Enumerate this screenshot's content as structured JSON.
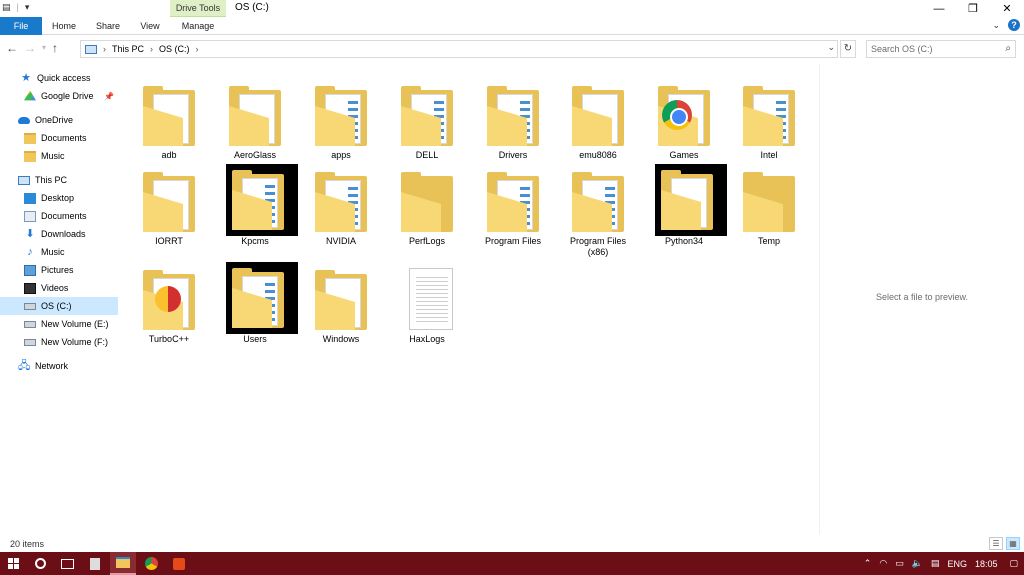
{
  "window": {
    "title": "OS (C:)",
    "context_tab": "Drive Tools",
    "controls": {
      "minimize": "—",
      "maximize": "❐",
      "close": "✕"
    }
  },
  "quick_access_toolbar": {
    "chevron": "▾"
  },
  "ribbon": {
    "tabs": [
      "File",
      "Home",
      "Share",
      "View",
      "Manage"
    ],
    "help": "?"
  },
  "address": {
    "crumbs": [
      "This PC",
      "OS (C:)"
    ],
    "search_placeholder": "Search OS (C:)"
  },
  "sidebar": {
    "items": [
      {
        "label": "Quick access",
        "icon": "star-icon"
      },
      {
        "label": "Google Drive",
        "icon": "google-drive-icon",
        "pinned": true
      },
      {
        "label": "OneDrive",
        "icon": "cloud-icon"
      },
      {
        "label": "Documents",
        "icon": "folder-icon"
      },
      {
        "label": "Music",
        "icon": "folder-icon"
      },
      {
        "label": "This PC",
        "icon": "computer-icon"
      },
      {
        "label": "Desktop",
        "icon": "desktop-icon"
      },
      {
        "label": "Documents",
        "icon": "documents-icon"
      },
      {
        "label": "Downloads",
        "icon": "download-icon"
      },
      {
        "label": "Music",
        "icon": "music-icon"
      },
      {
        "label": "Pictures",
        "icon": "pictures-icon"
      },
      {
        "label": "Videos",
        "icon": "videos-icon"
      },
      {
        "label": "OS (C:)",
        "icon": "drive-icon",
        "selected": true
      },
      {
        "label": "New Volume (E:)",
        "icon": "drive-icon"
      },
      {
        "label": "New Volume (F:)",
        "icon": "drive-icon"
      },
      {
        "label": "Network",
        "icon": "network-icon"
      }
    ]
  },
  "files": [
    {
      "name": "adb",
      "kind": "gear"
    },
    {
      "name": "AeroGlass",
      "kind": "plain"
    },
    {
      "name": "apps",
      "kind": "docs"
    },
    {
      "name": "DELL",
      "kind": "docs"
    },
    {
      "name": "Drivers",
      "kind": "docs"
    },
    {
      "name": "emu8086",
      "kind": "gear"
    },
    {
      "name": "Games",
      "kind": "chrome"
    },
    {
      "name": "Intel",
      "kind": "docs"
    },
    {
      "name": "IORRT",
      "kind": "gear"
    },
    {
      "name": "Kpcms",
      "kind": "docs",
      "black": true
    },
    {
      "name": "NVIDIA",
      "kind": "docs"
    },
    {
      "name": "PerfLogs",
      "kind": "empty"
    },
    {
      "name": "Program Files",
      "kind": "docs"
    },
    {
      "name": "Program Files (x86)",
      "kind": "docs"
    },
    {
      "name": "Python34",
      "kind": "plain",
      "black": true
    },
    {
      "name": "Temp",
      "kind": "empty"
    },
    {
      "name": "TurboC++",
      "kind": "turbo"
    },
    {
      "name": "Users",
      "kind": "docs",
      "black": true
    },
    {
      "name": "Windows",
      "kind": "gear"
    },
    {
      "name": "HaxLogs",
      "kind": "file"
    }
  ],
  "preview": {
    "text": "Select a file to preview."
  },
  "status": {
    "count": "20 items"
  },
  "taskbar": {
    "tray": {
      "lang": "ENG",
      "time": "18:05"
    }
  },
  "colors": {
    "accent": "#1979ca",
    "taskbar": "#6b0e16",
    "folder": "#e9c257",
    "selected": "#cce8ff"
  }
}
